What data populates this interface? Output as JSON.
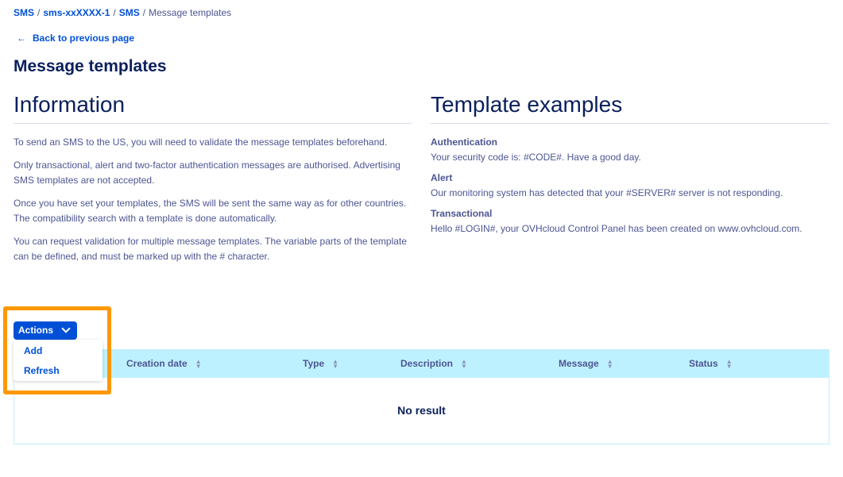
{
  "breadcrumb": {
    "items": [
      "SMS",
      "sms-xxXXXX-1",
      "SMS"
    ],
    "current": "Message templates"
  },
  "back_link": "Back to previous page",
  "page_title": "Message templates",
  "information": {
    "title": "Information",
    "paragraphs": [
      "To send an SMS to the US, you will need to validate the message templates beforehand.",
      "Only transactional, alert and two-factor authentication messages are authorised. Advertising SMS templates are not accepted.",
      "Once you have set your templates, the SMS will be sent the same way as for other countries. The compatibility search with a template is done automatically.",
      "You can request validation for multiple message templates. The variable parts of the template can be defined, and must be marked up with the # character."
    ]
  },
  "examples": {
    "title": "Template examples",
    "items": [
      {
        "label": "Authentication",
        "text": "Your security code is: #CODE#. Have a good day."
      },
      {
        "label": "Alert",
        "text": "Our monitoring system has detected that your #SERVER# server is not responding."
      },
      {
        "label": "Transactional",
        "text": "Hello #LOGIN#, your OVHcloud Control Panel has been created on www.ovhcloud.com."
      }
    ]
  },
  "actions": {
    "label": "Actions",
    "menu": [
      "Add",
      "Refresh"
    ]
  },
  "table": {
    "columns": [
      "Creation date",
      "Type",
      "Description",
      "Message",
      "Status"
    ],
    "empty_text": "No result"
  },
  "colors": {
    "primary": "#0050d7",
    "header_bg": "#bef1ff",
    "highlight": "#ff9800",
    "title": "#0a1f5c",
    "text": "#4d5592"
  }
}
